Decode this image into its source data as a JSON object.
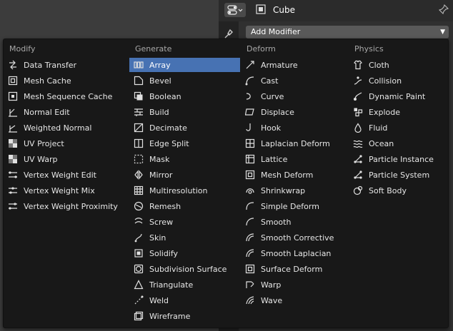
{
  "header": {
    "object_name": "Cube",
    "add_modifier_label": "Add Modifier"
  },
  "menu": {
    "columns": [
      {
        "heading": "Modify",
        "items": [
          {
            "label": "Data Transfer",
            "icon": "data-transfer-icon"
          },
          {
            "label": "Mesh Cache",
            "icon": "mesh-cache-icon"
          },
          {
            "label": "Mesh Sequence Cache",
            "icon": "mesh-sequence-cache-icon"
          },
          {
            "label": "Normal Edit",
            "icon": "normal-edit-icon"
          },
          {
            "label": "Weighted Normal",
            "icon": "weighted-normal-icon"
          },
          {
            "label": "UV Project",
            "icon": "uv-project-icon"
          },
          {
            "label": "UV Warp",
            "icon": "uv-warp-icon"
          },
          {
            "label": "Vertex Weight Edit",
            "icon": "vertex-weight-edit-icon"
          },
          {
            "label": "Vertex Weight Mix",
            "icon": "vertex-weight-mix-icon"
          },
          {
            "label": "Vertex Weight Proximity",
            "icon": "vertex-weight-proximity-icon"
          }
        ]
      },
      {
        "heading": "Generate",
        "items": [
          {
            "label": "Array",
            "icon": "array-icon",
            "active": true
          },
          {
            "label": "Bevel",
            "icon": "bevel-icon"
          },
          {
            "label": "Boolean",
            "icon": "boolean-icon"
          },
          {
            "label": "Build",
            "icon": "build-icon"
          },
          {
            "label": "Decimate",
            "icon": "decimate-icon"
          },
          {
            "label": "Edge Split",
            "icon": "edge-split-icon"
          },
          {
            "label": "Mask",
            "icon": "mask-icon"
          },
          {
            "label": "Mirror",
            "icon": "mirror-icon"
          },
          {
            "label": "Multiresolution",
            "icon": "multiresolution-icon"
          },
          {
            "label": "Remesh",
            "icon": "remesh-icon"
          },
          {
            "label": "Screw",
            "icon": "screw-icon"
          },
          {
            "label": "Skin",
            "icon": "skin-icon"
          },
          {
            "label": "Solidify",
            "icon": "solidify-icon"
          },
          {
            "label": "Subdivision Surface",
            "icon": "subdivision-surface-icon"
          },
          {
            "label": "Triangulate",
            "icon": "triangulate-icon"
          },
          {
            "label": "Weld",
            "icon": "weld-icon"
          },
          {
            "label": "Wireframe",
            "icon": "wireframe-icon"
          }
        ]
      },
      {
        "heading": "Deform",
        "items": [
          {
            "label": "Armature",
            "icon": "armature-icon"
          },
          {
            "label": "Cast",
            "icon": "cast-icon"
          },
          {
            "label": "Curve",
            "icon": "curve-icon"
          },
          {
            "label": "Displace",
            "icon": "displace-icon"
          },
          {
            "label": "Hook",
            "icon": "hook-icon"
          },
          {
            "label": "Laplacian Deform",
            "icon": "laplacian-deform-icon"
          },
          {
            "label": "Lattice",
            "icon": "lattice-icon"
          },
          {
            "label": "Mesh Deform",
            "icon": "mesh-deform-icon"
          },
          {
            "label": "Shrinkwrap",
            "icon": "shrinkwrap-icon"
          },
          {
            "label": "Simple Deform",
            "icon": "simple-deform-icon"
          },
          {
            "label": "Smooth",
            "icon": "smooth-icon"
          },
          {
            "label": "Smooth Corrective",
            "icon": "smooth-corrective-icon"
          },
          {
            "label": "Smooth Laplacian",
            "icon": "smooth-laplacian-icon"
          },
          {
            "label": "Surface Deform",
            "icon": "surface-deform-icon"
          },
          {
            "label": "Warp",
            "icon": "warp-icon"
          },
          {
            "label": "Wave",
            "icon": "wave-icon"
          }
        ]
      },
      {
        "heading": "Physics",
        "items": [
          {
            "label": "Cloth",
            "icon": "cloth-icon"
          },
          {
            "label": "Collision",
            "icon": "collision-icon"
          },
          {
            "label": "Dynamic Paint",
            "icon": "dynamic-paint-icon"
          },
          {
            "label": "Explode",
            "icon": "explode-icon"
          },
          {
            "label": "Fluid",
            "icon": "fluid-icon"
          },
          {
            "label": "Ocean",
            "icon": "ocean-icon"
          },
          {
            "label": "Particle Instance",
            "icon": "particle-instance-icon"
          },
          {
            "label": "Particle System",
            "icon": "particle-system-icon"
          },
          {
            "label": "Soft Body",
            "icon": "soft-body-icon"
          }
        ]
      }
    ]
  },
  "colors": {
    "menu_bg": "#181818",
    "highlight": "#4772b3",
    "heading_text": "#a8a8a8",
    "item_text": "#e6e6e6"
  }
}
